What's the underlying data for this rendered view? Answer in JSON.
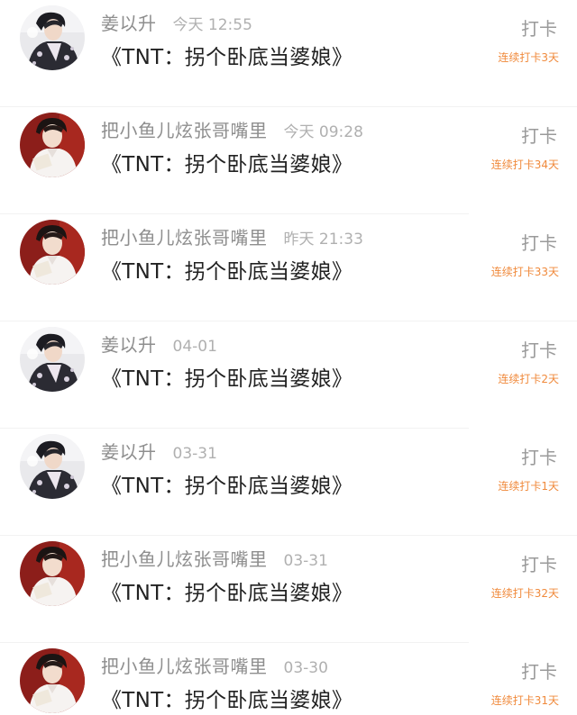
{
  "feed": {
    "items": [
      {
        "user": "姜以升",
        "time": "今天 12:55",
        "title": "《TNT：拐个卧底当婆娘》",
        "action": "打卡",
        "streak": "连续打卡3天",
        "avatar": "avatar-dark-icon"
      },
      {
        "user": "把小鱼儿炫张哥嘴里",
        "time": "今天 09:28",
        "title": "《TNT：拐个卧底当婆娘》",
        "action": "打卡",
        "streak": "连续打卡34天",
        "avatar": "avatar-red-icon"
      },
      {
        "user": "把小鱼儿炫张哥嘴里",
        "time": "昨天 21:33",
        "title": "《TNT：拐个卧底当婆娘》",
        "action": "打卡",
        "streak": "连续打卡33天",
        "avatar": "avatar-red-icon"
      },
      {
        "user": "姜以升",
        "time": "04-01",
        "title": "《TNT：拐个卧底当婆娘》",
        "action": "打卡",
        "streak": "连续打卡2天",
        "avatar": "avatar-dark-icon"
      },
      {
        "user": "姜以升",
        "time": "03-31",
        "title": "《TNT：拐个卧底当婆娘》",
        "action": "打卡",
        "streak": "连续打卡1天",
        "avatar": "avatar-dark-icon"
      },
      {
        "user": "把小鱼儿炫张哥嘴里",
        "time": "03-31",
        "title": "《TNT：拐个卧底当婆娘》",
        "action": "打卡",
        "streak": "连续打卡32天",
        "avatar": "avatar-red-icon"
      },
      {
        "user": "把小鱼儿炫张哥嘴里",
        "time": "03-30",
        "title": "《TNT：拐个卧底当婆娘》",
        "action": "打卡",
        "streak": "连续打卡31天",
        "avatar": "avatar-red-icon"
      }
    ]
  },
  "colors": {
    "username": "#8e8e8e",
    "time": "#b0b0b0",
    "title": "#222222",
    "action": "#9a9a9a",
    "streak": "#f08a3c"
  }
}
